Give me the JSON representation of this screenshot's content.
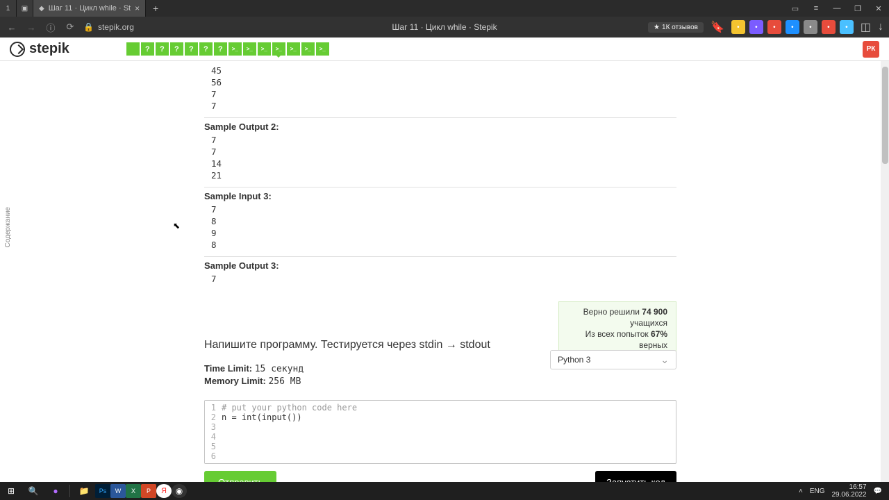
{
  "browser": {
    "tab_number": "1",
    "tab_title": "Шаг 11 · Цикл while · St",
    "page_title": "Шаг 11 · Цикл while · Stepik",
    "url_host": "stepik.org",
    "rating": "1К отзывов"
  },
  "stepik": {
    "brand": "stepik",
    "user_initials": "РК",
    "steps": [
      {
        "label": "",
        "type": "solid"
      },
      {
        "label": "?",
        "type": "q"
      },
      {
        "label": "?",
        "type": "q"
      },
      {
        "label": "?",
        "type": "q"
      },
      {
        "label": "?",
        "type": "q"
      },
      {
        "label": "?",
        "type": "q"
      },
      {
        "label": "?",
        "type": "q"
      },
      {
        "label": ">_",
        "type": "code"
      },
      {
        "label": ">_",
        "type": "code"
      },
      {
        "label": ">_",
        "type": "code"
      },
      {
        "label": ">_",
        "type": "code",
        "active": true
      },
      {
        "label": ">_",
        "type": "code"
      },
      {
        "label": ">_",
        "type": "code"
      },
      {
        "label": ">_",
        "type": "code"
      }
    ]
  },
  "sidebar_label": "Содержание",
  "samples": {
    "pre_lines": [
      "45",
      "56",
      "7",
      "7"
    ],
    "out2_label": "Sample Output 2:",
    "out2_lines": [
      "7",
      "7",
      "14",
      "21"
    ],
    "in3_label": "Sample Input 3:",
    "in3_lines": [
      "7",
      "8",
      "9",
      "8"
    ],
    "out3_label": "Sample Output 3:",
    "out3_lines": [
      "7"
    ]
  },
  "stats": {
    "line1_a": "Верно решили ",
    "line1_b": "74 900",
    "line1_c": " учащихся",
    "line2_a": "Из всех попыток ",
    "line2_b": "67%",
    "line2_c": " верных"
  },
  "task": {
    "title": "Напишите программу. Тестируется через stdin → stdout",
    "time_label": "Time Limit:",
    "time_val": "15 секунд",
    "mem_label": "Memory Limit:",
    "mem_val": "256 MB",
    "language": "Python 3"
  },
  "code": {
    "lines": [
      {
        "n": "1",
        "t": "# put your python code here",
        "cls": "code-comment"
      },
      {
        "n": "2",
        "t": "n = int(input())",
        "cls": ""
      },
      {
        "n": "3",
        "t": "",
        "cls": ""
      },
      {
        "n": "4",
        "t": "",
        "cls": ""
      },
      {
        "n": "5",
        "t": "",
        "cls": ""
      },
      {
        "n": "6",
        "t": "",
        "cls": ""
      }
    ]
  },
  "buttons": {
    "submit": "Отправить",
    "run": "Запустить код"
  },
  "taskbar": {
    "lang": "ENG",
    "time": "16:57",
    "date": "29.06.2022"
  },
  "ext_colors": [
    "#f4c430",
    "#7b5cff",
    "#e74c3c",
    "#1e90ff",
    "#8a8a8a",
    "#e74c3c",
    "#4ac0ff"
  ]
}
